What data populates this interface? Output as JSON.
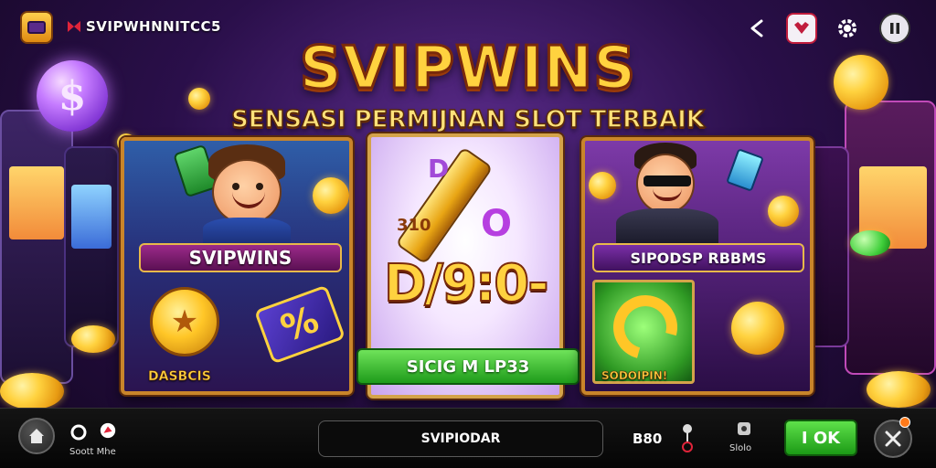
{
  "header": {
    "brand_text": "SVIPWHNNITCC5",
    "icons": [
      "game-logo-icon",
      "brand-icon",
      "share-icon",
      "heart-icon",
      "gear-icon",
      "pause-icon"
    ]
  },
  "title": {
    "main": "SVIPWINS",
    "subtitle": "SENSASI PERMIJNAN SLOT TERBAIK"
  },
  "panels": {
    "left": {
      "banner": "SVIPWINS",
      "caption": "DASBCIS"
    },
    "center": {
      "small_number": "310",
      "big_text": "D/9:0-",
      "button_label": "SICIG M LP33"
    },
    "right": {
      "banner": "SIPODSP RBBMS",
      "caption": "SODOIPIN!"
    }
  },
  "bottom_bar": {
    "left_label": "Soott Mhe",
    "search_value": "SVIPIODAR",
    "bet_value": "B80",
    "slot_label": "Slolo",
    "ok_label": "I OK"
  },
  "colors": {
    "title_gold": "#ffd23f",
    "accent_green": "#1e9b1a",
    "panel_border": "#c9852a",
    "notification": "#ff7a1a"
  }
}
